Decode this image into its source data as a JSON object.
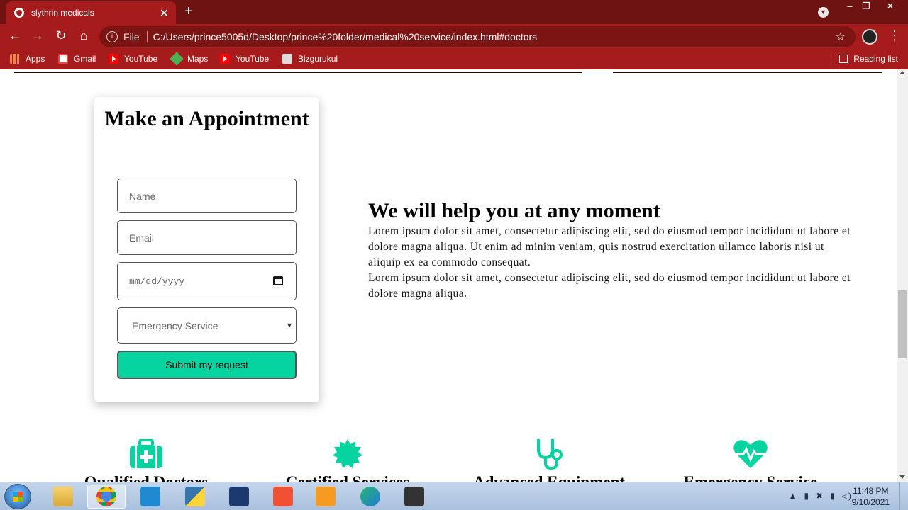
{
  "browser": {
    "tab_title": "slythrin medicals",
    "tab_close": "✕",
    "new_tab": "+",
    "url_scheme_label": "File",
    "url": "C:/Users/prince5005d/Desktop/prince%20folder/medical%20service/index.html#doctors",
    "bookmarks": [
      "Apps",
      "Gmail",
      "YouTube",
      "Maps",
      "YouTube",
      "Bizgurukul"
    ],
    "reading_list": "Reading list"
  },
  "appointment": {
    "title": "Make an Appointment",
    "name_placeholder": "Name",
    "email_placeholder": "Email",
    "date_placeholder": "mm/dd/yyyy",
    "service_selected": "Emergency Service",
    "submit_label": "Submit my request"
  },
  "help": {
    "heading": "We will help you at any moment",
    "paragraph1": "Lorem ipsum dolor sit amet, consectetur adipiscing elit, sed do eiusmod tempor incididunt ut labore et dolore magna aliqua. Ut enim ad minim veniam, quis nostrud exercitation ullamco laboris nisi ut aliquip ex ea commodo consequat.",
    "paragraph2": "Lorem ipsum dolor sit amet, consectetur adipiscing elit, sed do eiusmod tempor incididunt ut labore et dolore magna aliqua."
  },
  "features": [
    {
      "label": "Qualified Doctors",
      "icon": "medical-kit-icon"
    },
    {
      "label": "Certified Services",
      "icon": "certificate-badge-icon"
    },
    {
      "label": "Advanced Equipment",
      "icon": "stethoscope-icon"
    },
    {
      "label": "Emergency Service",
      "icon": "heartbeat-icon"
    }
  ],
  "colors": {
    "accent": "#05d3a0",
    "chrome": "#a61b1b",
    "titlebar": "#6f1212"
  },
  "taskbar": {
    "time": "11:48 PM",
    "date": "9/10/2021"
  }
}
